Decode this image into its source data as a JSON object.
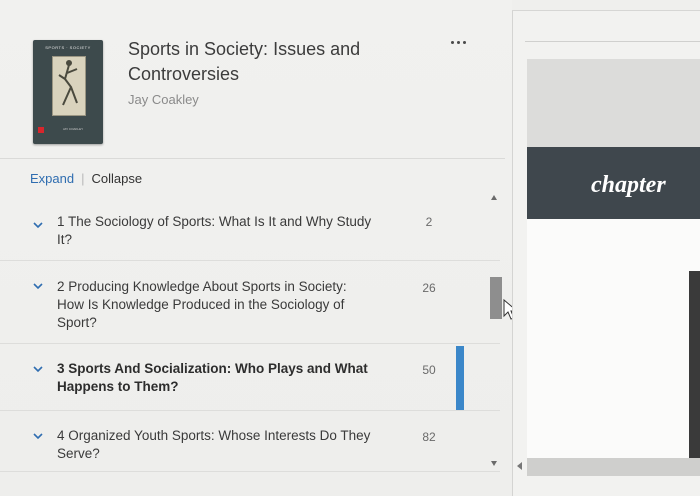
{
  "book": {
    "title": "Sports in Society: Issues and Controversies",
    "author": "Jay Coakley",
    "cover_title": "SPORTS · SOCIETY",
    "cover_author": "JAY COAKLEY"
  },
  "controls": {
    "expand_label": "Expand",
    "separator": "|",
    "collapse_label": "Collapse",
    "more_icon": "ellipsis-icon"
  },
  "toc": [
    {
      "title": "1 The Sociology of Sports: What Is It and Why Study It?",
      "page": "2",
      "active": false
    },
    {
      "title": "2 Producing Knowledge About Sports in Society: How Is Knowledge Produced in the Sociology of Sport?",
      "page": "26",
      "active": false
    },
    {
      "title": "3 Sports And Socialization: Who Plays and What Happens to Them?",
      "page": "50",
      "active": true
    },
    {
      "title": "4 Organized Youth Sports: Whose Interests Do They Serve?",
      "page": "82",
      "active": false
    }
  ],
  "preview": {
    "chapter_word": "chapter"
  },
  "colors": {
    "link": "#2f6db0",
    "active_marker": "#3b87c9",
    "chapter_band": "#3f474d"
  }
}
